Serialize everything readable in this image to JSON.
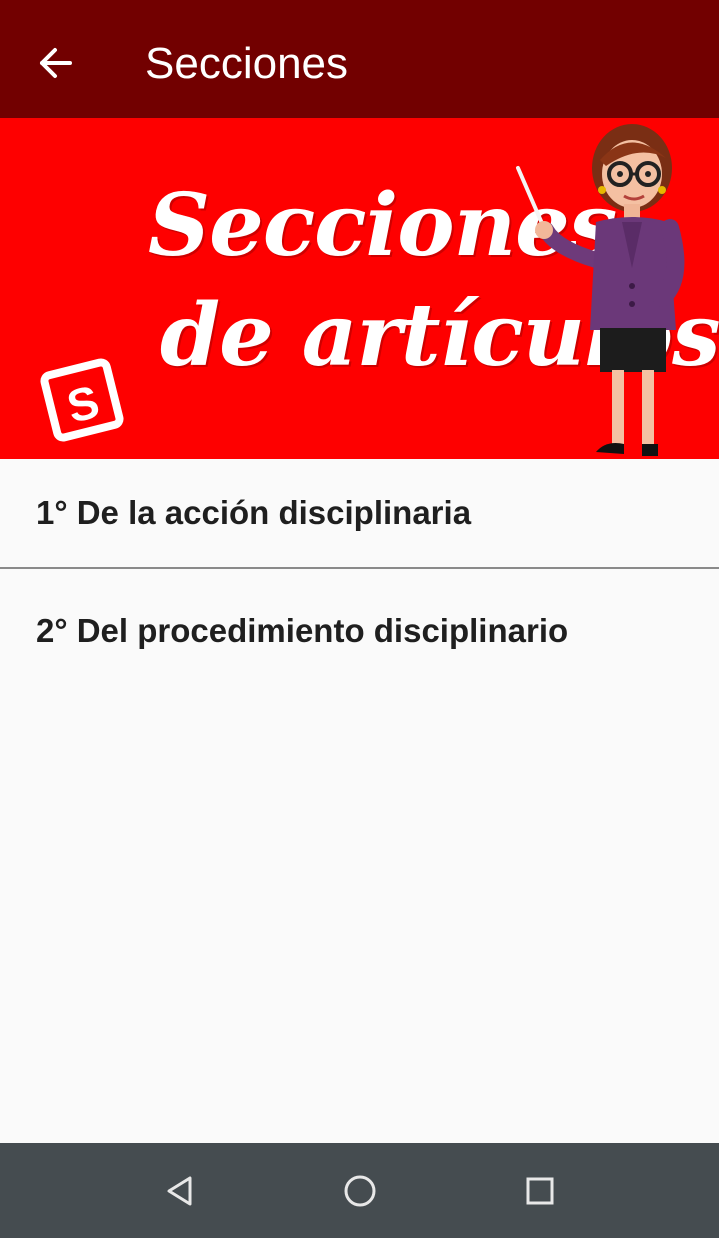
{
  "appbar": {
    "title": "Secciones",
    "back_icon": "arrow-left-icon",
    "color": "#720000"
  },
  "banner": {
    "line1": "Secciones",
    "line2": "de artículos",
    "logo_letter": "S",
    "background_color": "#fe0000"
  },
  "list": {
    "items": [
      {
        "label": "1° De la acción disciplinaria"
      },
      {
        "label": "2° Del procedimiento disciplinario"
      }
    ]
  },
  "navbar": {
    "back_icon": "triangle-back-icon",
    "home_icon": "circle-home-icon",
    "recents_icon": "square-recents-icon",
    "color": "#454c50"
  }
}
